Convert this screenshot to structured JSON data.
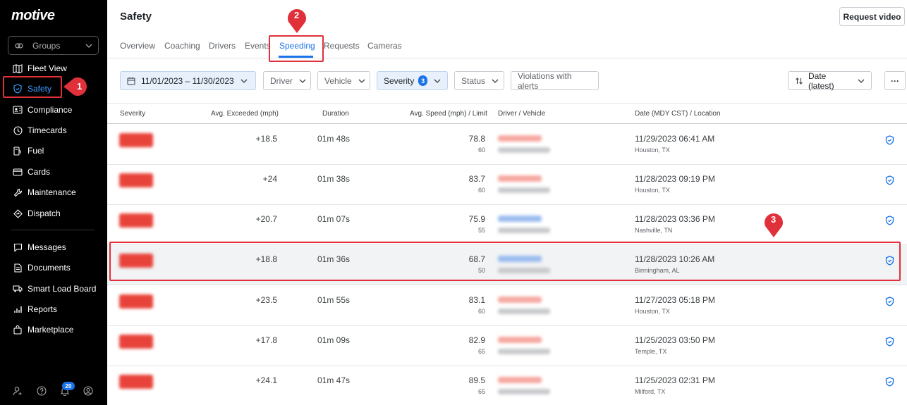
{
  "app": {
    "logo": "motive"
  },
  "sidebar": {
    "groups_label": "Groups",
    "items": [
      {
        "label": "Fleet View",
        "icon": "map-icon"
      },
      {
        "label": "Safety",
        "icon": "shield-icon",
        "active": true
      },
      {
        "label": "Compliance",
        "icon": "id-card-icon"
      },
      {
        "label": "Timecards",
        "icon": "clock-icon"
      },
      {
        "label": "Fuel",
        "icon": "fuel-icon"
      },
      {
        "label": "Cards",
        "icon": "card-icon"
      },
      {
        "label": "Maintenance",
        "icon": "wrench-icon"
      },
      {
        "label": "Dispatch",
        "icon": "dispatch-icon"
      },
      {
        "label": "Messages",
        "icon": "message-icon"
      },
      {
        "label": "Documents",
        "icon": "document-icon"
      },
      {
        "label": "Smart Load Board",
        "icon": "truck-icon"
      },
      {
        "label": "Reports",
        "icon": "reports-icon"
      },
      {
        "label": "Marketplace",
        "icon": "bag-icon"
      }
    ],
    "notification_count": "20"
  },
  "header": {
    "title": "Safety",
    "request_video": "Request video",
    "tabs": [
      {
        "label": "Overview"
      },
      {
        "label": "Coaching"
      },
      {
        "label": "Drivers"
      },
      {
        "label": "Events"
      },
      {
        "label": "Speeding",
        "active": true
      },
      {
        "label": "Requests"
      },
      {
        "label": "Cameras"
      }
    ]
  },
  "filters": {
    "date_range": "11/01/2023 – 11/30/2023",
    "driver": "Driver",
    "vehicle": "Vehicle",
    "severity": "Severity",
    "severity_count": "3",
    "status": "Status",
    "violations": "Violations with alerts",
    "sort": "Date (latest)",
    "more": "···"
  },
  "table": {
    "columns": {
      "severity": "Severity",
      "exceeded": "Avg. Exceeded (mph)",
      "duration": "Duration",
      "speed": "Avg. Speed (mph) / Limit",
      "driver": "Driver / Vehicle",
      "date": "Date (MDY CST) / Location"
    },
    "rows": [
      {
        "exceeded": "+18.5",
        "duration": "01m 48s",
        "speed": "78.8",
        "limit": "60",
        "date": "11/29/2023 06:41 AM",
        "location": "Houston, TX",
        "driver_color": "red"
      },
      {
        "exceeded": "+24",
        "duration": "01m 38s",
        "speed": "83.7",
        "limit": "60",
        "date": "11/28/2023 09:19 PM",
        "location": "Houston, TX",
        "driver_color": "red"
      },
      {
        "exceeded": "+20.7",
        "duration": "01m 07s",
        "speed": "75.9",
        "limit": "55",
        "date": "11/28/2023 03:36 PM",
        "location": "Nashville, TN",
        "driver_color": "blue"
      },
      {
        "exceeded": "+18.8",
        "duration": "01m 36s",
        "speed": "68.7",
        "limit": "50",
        "date": "11/28/2023 10:26 AM",
        "location": "Birmingham, AL",
        "driver_color": "blue",
        "highlighted": true
      },
      {
        "exceeded": "+23.5",
        "duration": "01m 55s",
        "speed": "83.1",
        "limit": "60",
        "date": "11/27/2023 05:18 PM",
        "location": "Houston, TX",
        "driver_color": "red"
      },
      {
        "exceeded": "+17.8",
        "duration": "01m 09s",
        "speed": "82.9",
        "limit": "65",
        "date": "11/25/2023 03:50 PM",
        "location": "Temple, TX",
        "driver_color": "red"
      },
      {
        "exceeded": "+24.1",
        "duration": "01m 47s",
        "speed": "89.5",
        "limit": "65",
        "date": "11/25/2023 02:31 PM",
        "location": "Milford, TX",
        "driver_color": "red"
      }
    ]
  },
  "annotations": [
    {
      "label": "1"
    },
    {
      "label": "2"
    },
    {
      "label": "3"
    }
  ],
  "colors": {
    "accent": "#1a73e8",
    "annotation": "#e0303a",
    "sidebar_bg": "#000000",
    "severity": "#e8433a"
  }
}
